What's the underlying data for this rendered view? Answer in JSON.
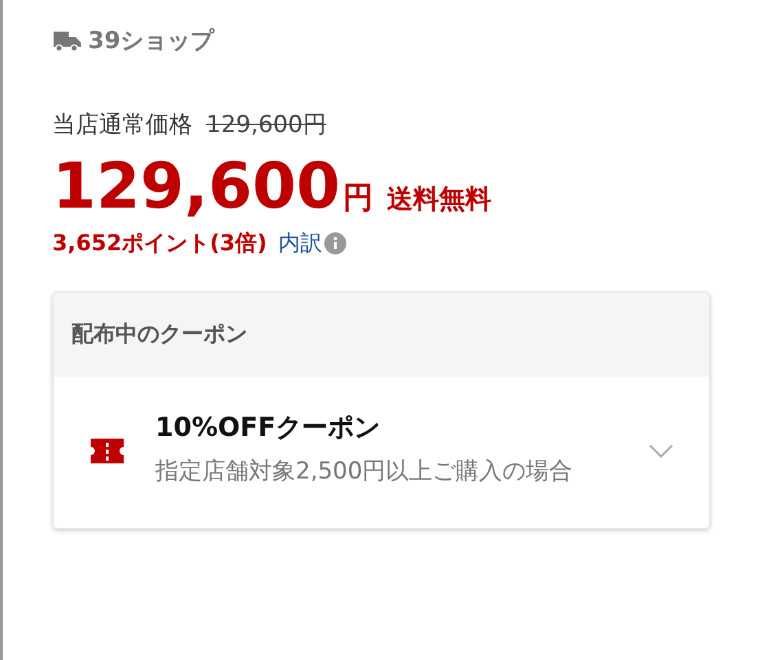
{
  "shop": {
    "name": "39ショップ"
  },
  "regular_price": {
    "label": "当店通常価格",
    "value": "129,600円"
  },
  "price": {
    "amount": "129,600",
    "unit": "円",
    "shipping": "送料無料"
  },
  "points": {
    "text": "3,652ポイント(3倍)",
    "link": "内訳"
  },
  "coupons": {
    "title": "配布中のクーポン",
    "items": [
      {
        "title": "10%OFFクーポン",
        "description": "指定店舗対象2,500円以上ご購入の場合",
        "expanded": false
      }
    ]
  }
}
